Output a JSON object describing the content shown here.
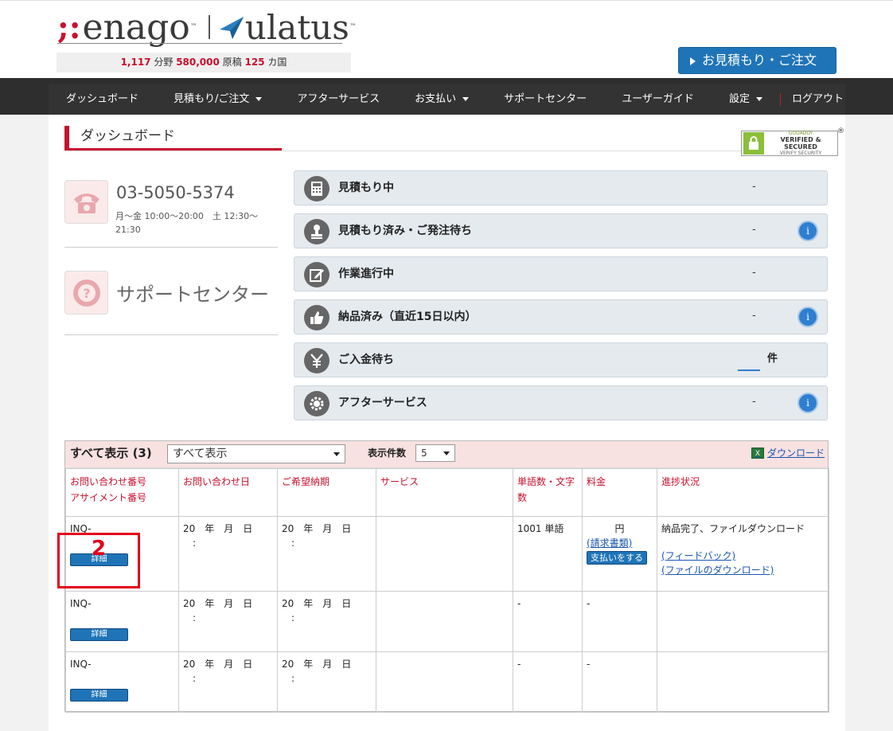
{
  "header": {
    "logo_enago": "enago",
    "logo_ulatus": "ulatus",
    "logo_tm": "™",
    "stats": {
      "fields": "1,117",
      "fields_label": "分野",
      "manuscripts": "580,000",
      "manuscripts_label": "原稿",
      "countries": "125",
      "countries_label": "カ国"
    },
    "quote_button": "お見積もり・ご注文"
  },
  "nav": {
    "items": [
      "ダッシュボード",
      "見積もり/ご注文",
      "アフターサービス",
      "お支払い",
      "サポートセンター",
      "ユーザーガイド"
    ],
    "settings": "設定",
    "logout": "ログアウト"
  },
  "page": {
    "title": "ダッシュボード",
    "badge": {
      "line1": "GODADDY",
      "line2": "VERIFIED & SECURED",
      "line3": "VERIFY SECURITY",
      "reg": "®"
    }
  },
  "contact": {
    "phone": "03-5050-5374",
    "hours": "月～金 10:00～20:00　土 12:30～21:30"
  },
  "support": {
    "label": "サポートセンター"
  },
  "cards": [
    {
      "label": "見積もり中",
      "value": "-"
    },
    {
      "label": "見積もり済み・ご発注待ち",
      "value": "-"
    },
    {
      "label": "作業進行中",
      "value": "-"
    },
    {
      "label": "納品済み（直近15日以内）",
      "value": "-"
    },
    {
      "label": "ご入金待ち",
      "unit": "件"
    },
    {
      "label": "アフターサービス",
      "value": "-"
    }
  ],
  "info_glyph": "i",
  "table": {
    "title": "すべて表示 (3)",
    "filter_value": "すべて表示",
    "count_label": "表示件数",
    "count_value": "5",
    "download": "ダウンロード",
    "xls": "X",
    "headers": {
      "inquiry": "お問い合わせ番号",
      "assignment": "アサイメント番号",
      "date": "お問い合わせ日",
      "deadline": "ご希望納期",
      "service": "サービス",
      "words": "単語数・文字数",
      "price": "料金",
      "status": "進捗状況"
    },
    "rows": [
      {
        "inq": "INQ-",
        "date": "20　年　月　日",
        "deadline": "20　年　月　日",
        "time": ":",
        "service": "",
        "words": "1001 単語",
        "price": "円",
        "invoice": "(請求書類)",
        "pay": "支払いをする",
        "status": "納品完了、ファイルダウンロード",
        "feedback": "(フィードバック)",
        "file_dl": "(ファイルのダウンロード)",
        "detail": "詳細"
      },
      {
        "inq": "INQ-",
        "date": "20　年　月　日",
        "deadline": "20　年　月　日",
        "time": ":",
        "service": "",
        "words": "-",
        "price": "-",
        "status": "",
        "detail": "詳細"
      },
      {
        "inq": "INQ-",
        "date": "20　年　月　日",
        "deadline": "20　年　月　日",
        "time": ":",
        "service": "",
        "words": "-",
        "price": "-",
        "status": "",
        "detail": "詳細"
      }
    ]
  },
  "annotation": {
    "number": "2"
  }
}
